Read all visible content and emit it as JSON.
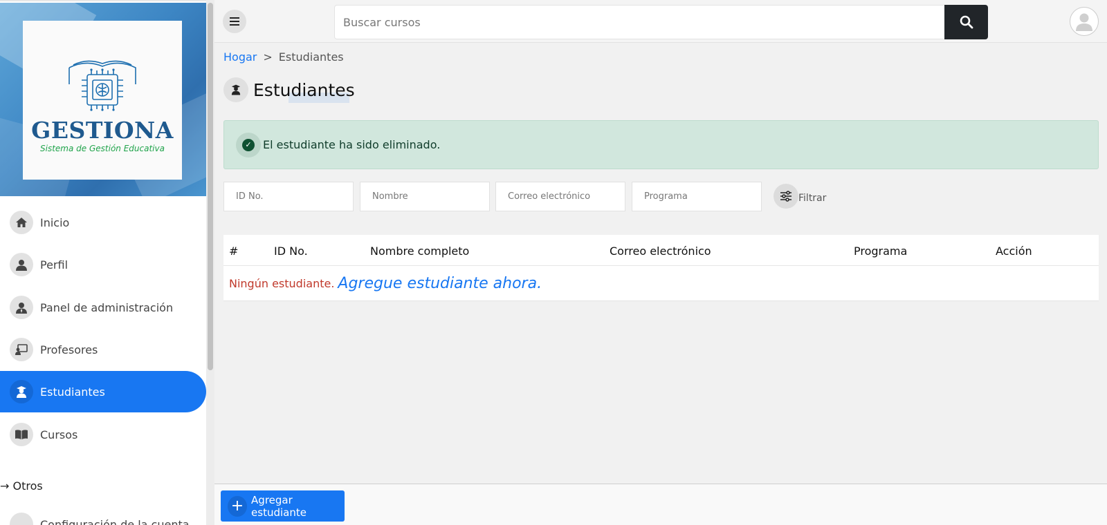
{
  "brand": {
    "name": "GESTIONA",
    "tagline": "Sistema de Gestión Educativa",
    "colors": {
      "name": "#1f5a8f",
      "tagline": "#1fa34a",
      "background": "#3d86c4"
    }
  },
  "sidebar": {
    "items": [
      {
        "label": "Inicio",
        "icon": "home-icon"
      },
      {
        "label": "Perfil",
        "icon": "user-icon"
      },
      {
        "label": "Panel de administración",
        "icon": "admin-user-icon"
      },
      {
        "label": "Profesores",
        "icon": "teacher-board-icon"
      },
      {
        "label": "Estudiantes",
        "icon": "student-icon",
        "active": true
      },
      {
        "label": "Cursos",
        "icon": "book-icon"
      }
    ],
    "section_label": "→ Otros",
    "partial_item": {
      "label": "Configuración de la cuenta",
      "icon": "gear-icon"
    }
  },
  "topbar": {
    "search_placeholder": "Buscar cursos",
    "search_icon": "search-icon",
    "menu_icon": "hamburger-icon"
  },
  "breadcrumb": {
    "home": "Hogar",
    "separator": ">",
    "current": "Estudiantes"
  },
  "page": {
    "title": "Estudiantes",
    "icon": "student-icon"
  },
  "alert": {
    "text": "El estudiante ha sido eliminado.",
    "icon": "check-circle-icon",
    "color": "#d1e7dd"
  },
  "filters": {
    "id_placeholder": "ID No.",
    "name_placeholder": "Nombre",
    "email_placeholder": "Correo electrónico",
    "program_placeholder": "Programa",
    "button_label": "Filtrar",
    "button_icon": "sliders-icon"
  },
  "table": {
    "columns": [
      "#",
      "ID No.",
      "Nombre completo",
      "Correo electrónico",
      "Programa",
      "Acción"
    ],
    "empty_message": "Ningún estudiante.",
    "empty_link": "Agregue estudiante ahora."
  },
  "actions": {
    "add_label": "Agregar estudiante",
    "add_icon": "plus-icon",
    "accent": "#1877f2"
  }
}
